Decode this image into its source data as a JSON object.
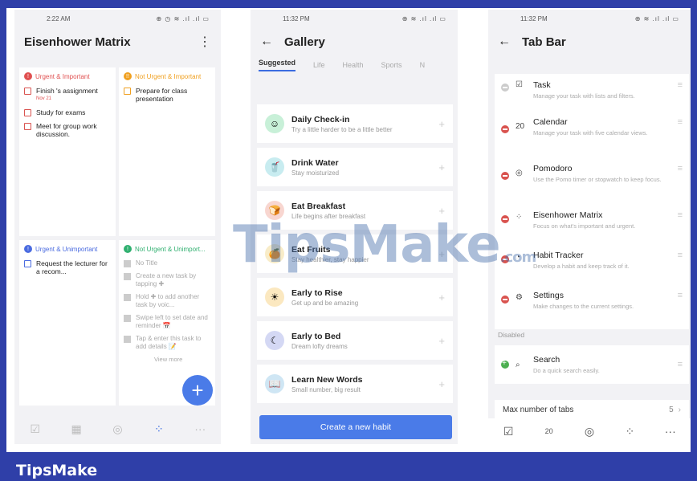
{
  "brand": {
    "footer": "TipsMake",
    "watermark_main": "TipsMake",
    "watermark_suffix": ".com"
  },
  "colors": {
    "frame": "#2f3fa8",
    "accent": "#4a7be8",
    "danger": "#d9534f"
  },
  "phone1": {
    "status": {
      "time": "2:22 AM",
      "icons": "⊕ ◷ ≋ .ıl .ıl ▭"
    },
    "title": "Eisenhower Matrix",
    "quadrants": [
      {
        "label": "Urgent & Important",
        "color": "#e05050",
        "badge": "!",
        "tasks": [
          {
            "text": "Finish 's assignment",
            "sub": "Nov 21"
          },
          {
            "text": "Study for exams",
            "sub": ""
          },
          {
            "text": "Meet for group work discussion.",
            "sub": ""
          }
        ]
      },
      {
        "label": "Not Urgent & Important",
        "color": "#f0a020",
        "badge": "!!",
        "tasks": [
          {
            "text": "Prepare for class presentation",
            "sub": ""
          }
        ]
      },
      {
        "label": "Urgent & Unimportant",
        "color": "#4a6be0",
        "badge": "!",
        "tasks": [
          {
            "text": "Request the lecturer for a recom...",
            "sub": ""
          }
        ]
      },
      {
        "label": "Not Urgent & Unimport...",
        "color": "#30b070",
        "badge": "!",
        "hints": [
          "No Title",
          "Create a new task by tapping ✚",
          "Hold ✚ to add another task by voic...",
          "Swipe left to set date and reminder 📅",
          "Tap & enter this task to add details 📝"
        ],
        "more": "View more"
      }
    ],
    "fab": "+",
    "tabbar": [
      "☑",
      "▦",
      "◎",
      "⁘",
      "···"
    ]
  },
  "phone2": {
    "status": {
      "time": "11:32 PM",
      "icons": "⊕ ≋ .ıl .ıl ▭"
    },
    "title": "Gallery",
    "tabs": [
      "Suggested",
      "Life",
      "Health",
      "Sports",
      "N"
    ],
    "habits": [
      {
        "name": "Daily Check-in",
        "desc": "Try a little harder to be a little better",
        "bg": "#c8f0d8",
        "icon": "☺"
      },
      {
        "name": "Drink Water",
        "desc": "Stay moisturized",
        "bg": "#c8ecf0",
        "icon": "🥤"
      },
      {
        "name": "Eat Breakfast",
        "desc": "Life begins after breakfast",
        "bg": "#f8d6d0",
        "icon": "🍞"
      },
      {
        "name": "Eat Fruits",
        "desc": "Stay healthier, stay happier",
        "bg": "#f8ecc8",
        "icon": "🍊"
      },
      {
        "name": "Early to Rise",
        "desc": "Get up and be amazing",
        "bg": "#fbe8c0",
        "icon": "☀"
      },
      {
        "name": "Early to Bed",
        "desc": "Dream lofty dreams",
        "bg": "#d4d8f4",
        "icon": "☾"
      },
      {
        "name": "Learn New Words",
        "desc": "Small number, big result",
        "bg": "#cfe6f4",
        "icon": "📖"
      }
    ],
    "create_label": "Create a new habit"
  },
  "phone3": {
    "status": {
      "time": "11:32 PM",
      "icons": "⊕ ≋ .ıl .ıl ▭"
    },
    "title": "Tab Bar",
    "enabled": [
      {
        "name": "Task",
        "desc": "Manage your task with lists and filters.",
        "icon": "☑",
        "fixed": true
      },
      {
        "name": "Calendar",
        "desc": "Manage your task with five calendar views.",
        "icon": "20",
        "fixed": false
      },
      {
        "name": "Pomodoro",
        "desc": "Use the Pomo timer or stopwatch to keep focus.",
        "icon": "◎",
        "fixed": false
      },
      {
        "name": "Eisenhower Matrix",
        "desc": "Focus on what's important and urgent.",
        "icon": "⁘",
        "fixed": false
      },
      {
        "name": "Habit Tracker",
        "desc": "Develop a habit and keep track of it.",
        "icon": "◔",
        "fixed": false
      },
      {
        "name": "Settings",
        "desc": "Make changes to the current settings.",
        "icon": "⚙",
        "fixed": false
      }
    ],
    "disabled_label": "Disabled",
    "disabled": [
      {
        "name": "Search",
        "desc": "Do a quick search easily.",
        "icon": "⌕"
      }
    ],
    "max_tabs_label": "Max number of tabs",
    "max_tabs_value": "5",
    "tabbar": [
      "☑",
      "20",
      "◎",
      "⁘",
      "···"
    ]
  }
}
